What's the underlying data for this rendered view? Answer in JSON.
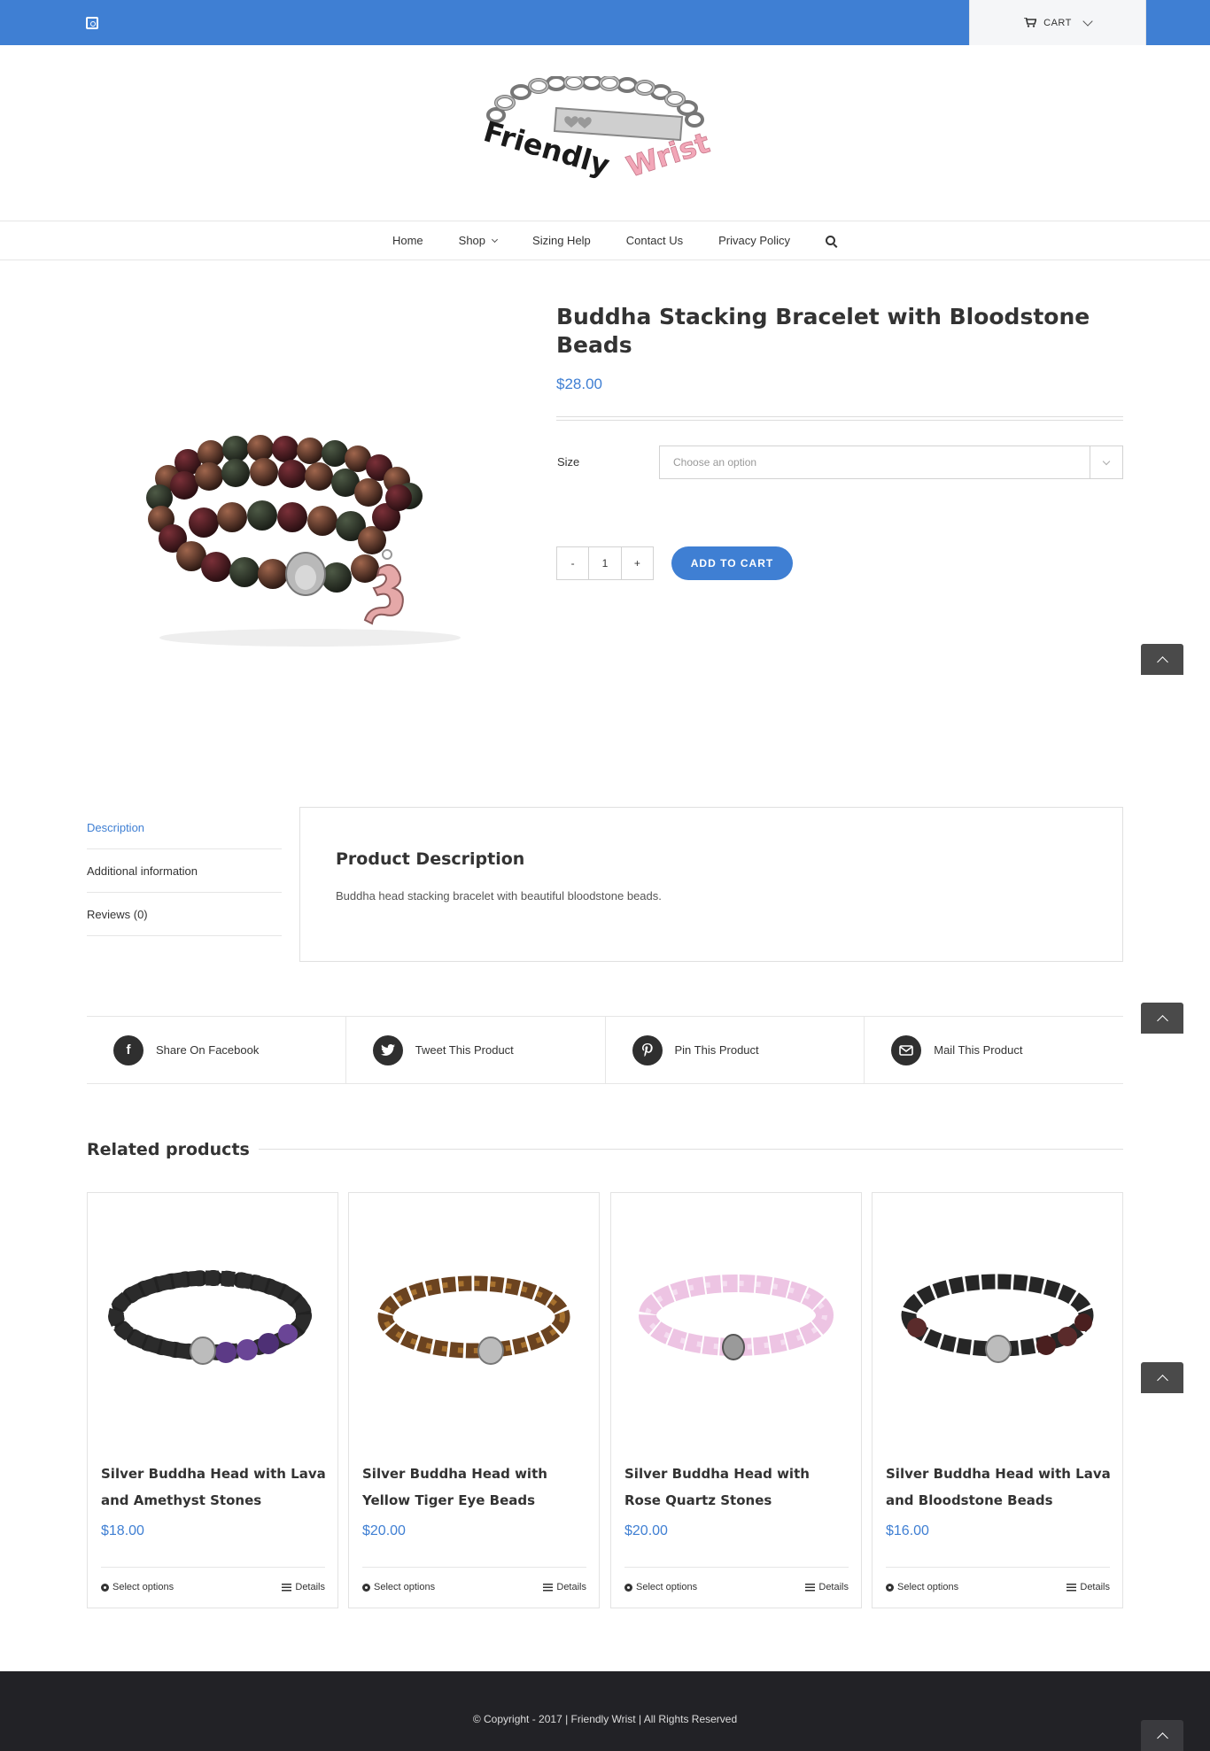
{
  "topbar": {
    "cart_label": "CART"
  },
  "logo": {
    "word1": "Friendly",
    "word2": "Wrist"
  },
  "nav": {
    "items": [
      "Home",
      "Shop",
      "Sizing Help",
      "Contact Us",
      "Privacy Policy"
    ]
  },
  "product": {
    "title": "Buddha Stacking Bracelet with Bloodstone Beads",
    "price": "$28.00",
    "size_label": "Size",
    "size_placeholder": "Choose an option",
    "qty_minus": "-",
    "qty_value": "1",
    "qty_plus": "+",
    "add_to_cart": "ADD TO CART"
  },
  "tabs": {
    "items": [
      "Description",
      "Additional information",
      "Reviews (0)"
    ],
    "panel_title": "Product Description",
    "panel_text": "Buddha head stacking bracelet with beautiful bloodstone beads."
  },
  "share": {
    "items": [
      "Share On Facebook",
      "Tweet This Product",
      "Pin This Product",
      "Mail This Product"
    ]
  },
  "related": {
    "title": "Related products",
    "products": [
      {
        "name": "Silver Buddha Head with Lava and Amethyst Stones",
        "price": "$18.00",
        "options": "Select options",
        "details": "Details"
      },
      {
        "name": "Silver Buddha Head with Yellow Tiger Eye Beads",
        "price": "$20.00",
        "options": "Select options",
        "details": "Details"
      },
      {
        "name": "Silver Buddha Head with Rose Quartz Stones",
        "price": "$20.00",
        "options": "Select options",
        "details": "Details"
      },
      {
        "name": "Silver Buddha Head with Lava and Bloodstone Beads",
        "price": "$16.00",
        "options": "Select options",
        "details": "Details"
      }
    ]
  },
  "footer": {
    "copyright": "© Copyright - 2017 | Friendly Wrist | All Rights Reserved"
  },
  "colors": {
    "accent": "#3f7fd3",
    "footer_bg": "#222226",
    "dark_text": "#333333"
  }
}
